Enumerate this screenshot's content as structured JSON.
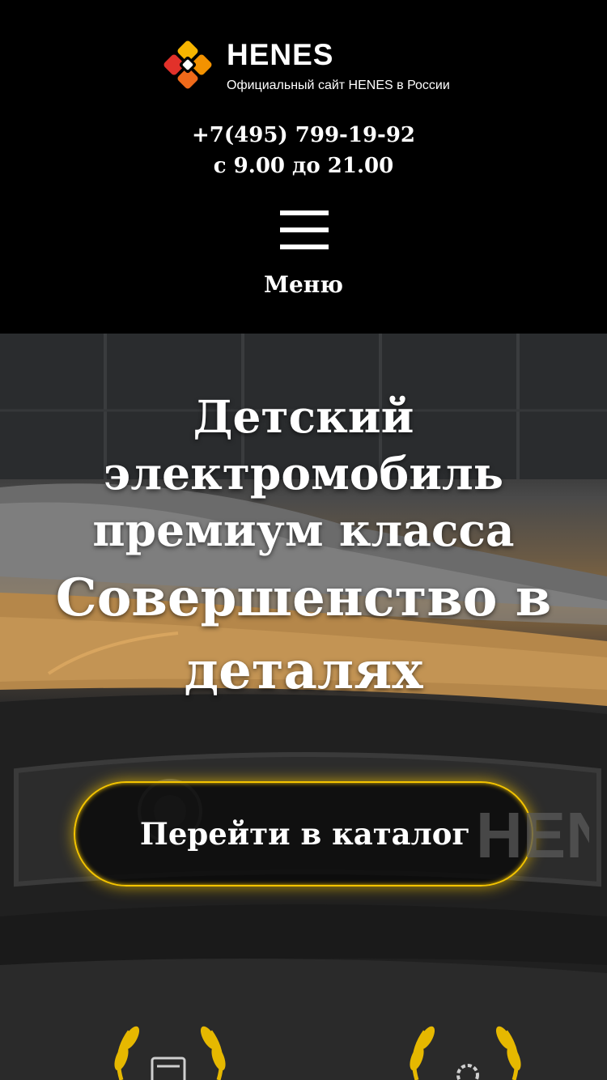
{
  "header": {
    "logo": {
      "name": "HENES",
      "tagline": "Официальный сайт HENES в России"
    },
    "phone": "+7(495) 799-19-92",
    "hours": "с 9.00 до 21.00",
    "menu_label": "Меню"
  },
  "hero": {
    "title": "Детский электромобиль премиум класса",
    "subtitle": "Совершенство в деталях",
    "cta_label": "Перейти в каталог",
    "badge_text": "HENES"
  },
  "colors": {
    "background": "#000000",
    "accent": "#f4c400",
    "logo_orange": "#f39200",
    "logo_red": "#e2312a",
    "logo_yellow": "#f7b500"
  },
  "icons": [
    "hamburger-menu-icon",
    "laurel-wreath-icon",
    "document-icon",
    "gear-icon"
  ]
}
